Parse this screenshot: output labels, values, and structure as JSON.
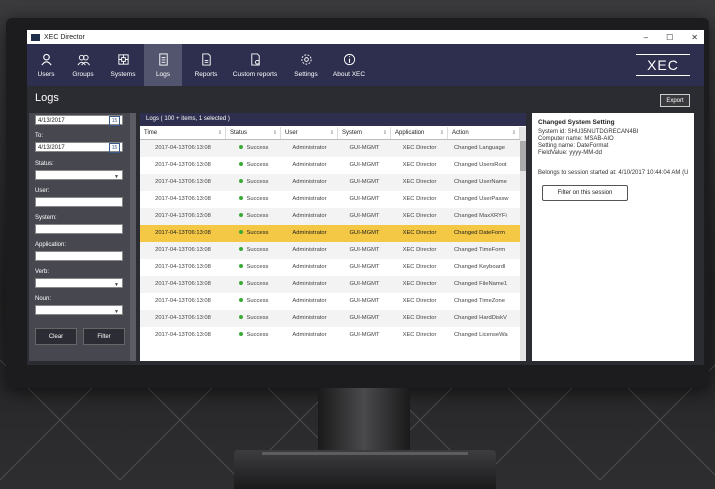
{
  "window": {
    "title": "XEC Director",
    "controls": [
      "–",
      "☐",
      "✕"
    ]
  },
  "nav": {
    "items": [
      {
        "label": "Users",
        "icon": "user-icon"
      },
      {
        "label": "Groups",
        "icon": "groups-icon"
      },
      {
        "label": "Systems",
        "icon": "systems-icon"
      },
      {
        "label": "Logs",
        "icon": "logs-icon",
        "active": true
      },
      {
        "label": "Reports",
        "icon": "reports-icon"
      },
      {
        "label": "Custom reports",
        "icon": "custom-reports-icon"
      },
      {
        "label": "Settings",
        "icon": "settings-icon"
      },
      {
        "label": "About XEC",
        "icon": "info-icon"
      }
    ],
    "logo": "XEC"
  },
  "page": {
    "title": "Logs",
    "export_label": "Export"
  },
  "filters": {
    "from_value": "4/13/2017",
    "to_label": "To:",
    "to_value": "4/13/2017",
    "status_label": "Status:",
    "user_label": "User:",
    "system_label": "System:",
    "application_label": "Application:",
    "verb_label": "Verb:",
    "noun_label": "Noun:",
    "clear_label": "Clear",
    "filter_label": "Filter",
    "calendar_glyph": "15"
  },
  "grid": {
    "header": "Logs ( 100 + items, 1 selected )",
    "columns": [
      "Time",
      "Status",
      "User",
      "System",
      "Application",
      "Action"
    ],
    "rows": [
      {
        "time": "2017-04-13T06:13:08",
        "status": "Success",
        "user": "Administrator",
        "system": "GUI-MGMT",
        "application": "XEC Director",
        "action": "Changed Language"
      },
      {
        "time": "2017-04-13T06:13:08",
        "status": "Success",
        "user": "Administrator",
        "system": "GUI-MGMT",
        "application": "XEC Director",
        "action": "Changed UsersRoot"
      },
      {
        "time": "2017-04-13T06:13:08",
        "status": "Success",
        "user": "Administrator",
        "system": "GUI-MGMT",
        "application": "XEC Director",
        "action": "Changed UserName"
      },
      {
        "time": "2017-04-13T06:13:08",
        "status": "Success",
        "user": "Administrator",
        "system": "GUI-MGMT",
        "application": "XEC Director",
        "action": "Changed UserPassw"
      },
      {
        "time": "2017-04-13T06:13:08",
        "status": "Success",
        "user": "Administrator",
        "system": "GUI-MGMT",
        "application": "XEC Director",
        "action": "Changed MaxXRYFi"
      },
      {
        "time": "2017-04-13T06:13:08",
        "status": "Success",
        "user": "Administrator",
        "system": "GUI-MGMT",
        "application": "XEC Director",
        "action": "Changed DateForm",
        "selected": true
      },
      {
        "time": "2017-04-13T06:13:08",
        "status": "Success",
        "user": "Administrator",
        "system": "GUI-MGMT",
        "application": "XEC Director",
        "action": "Changed TimeForm"
      },
      {
        "time": "2017-04-13T06:13:08",
        "status": "Success",
        "user": "Administrator",
        "system": "GUI-MGMT",
        "application": "XEC Director",
        "action": "Changed Keyboardl"
      },
      {
        "time": "2017-04-13T06:13:08",
        "status": "Success",
        "user": "Administrator",
        "system": "GUI-MGMT",
        "application": "XEC Director",
        "action": "Changed FileName1"
      },
      {
        "time": "2017-04-13T06:13:08",
        "status": "Success",
        "user": "Administrator",
        "system": "GUI-MGMT",
        "application": "XEC Director",
        "action": "Changed TimeZone"
      },
      {
        "time": "2017-04-13T06:13:08",
        "status": "Success",
        "user": "Administrator",
        "system": "GUI-MGMT",
        "application": "XEC Director",
        "action": "Changed HardDiskV"
      },
      {
        "time": "2017-04-13T06:13:08",
        "status": "Success",
        "user": "Administrator",
        "system": "GUI-MGMT",
        "application": "XEC Director",
        "action": "Changed LicenseWa"
      }
    ]
  },
  "detail": {
    "title": "Changed System Setting",
    "system_id": "System id: SHU35NUTDGRECAN4BI",
    "computer_name": "Computer name: MSAB-AIO",
    "setting_name": "Setting name: DateFormat",
    "field_value": "FieldValue: yyyy-MM-dd",
    "session": "Belongs to session started at: 4/10/2017 10:44:04 AM (U",
    "filter_session_label": "Filter on this session"
  },
  "colors": {
    "nav_bg": "#2e2f4e",
    "nav_active": "#53556e",
    "selected_row": "#f4c744",
    "success_dot": "#3aaa35"
  }
}
